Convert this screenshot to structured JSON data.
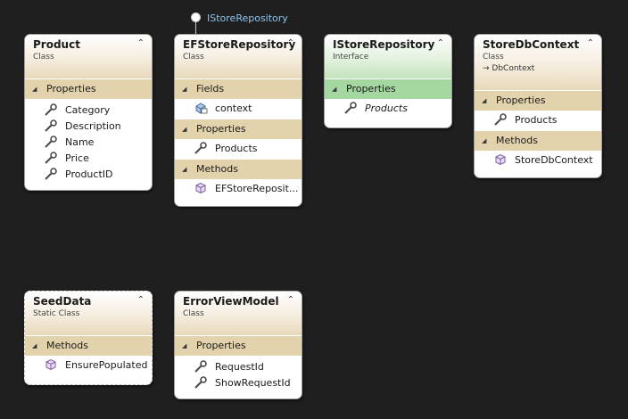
{
  "lollipop_label": "IStoreRepository",
  "collapse_glyph": "⌃",
  "section_glyph": "◢",
  "classes": {
    "product": {
      "title": "Product",
      "kind": "Class",
      "sections": [
        {
          "name": "Properties",
          "members": [
            "Category",
            "Description",
            "Name",
            "Price",
            "ProductID"
          ]
        }
      ]
    },
    "efstore": {
      "title": "EFStoreRepository",
      "kind": "Class",
      "sections": [
        {
          "name": "Fields",
          "members": [
            "context"
          ]
        },
        {
          "name": "Properties",
          "members": [
            "Products"
          ]
        },
        {
          "name": "Methods",
          "members": [
            "EFStoreReposit..."
          ]
        }
      ]
    },
    "istore": {
      "title": "IStoreRepository",
      "kind": "Interface",
      "sections": [
        {
          "name": "Properties",
          "members": [
            "Products"
          ]
        }
      ]
    },
    "storedb": {
      "title": "StoreDbContext",
      "kind": "Class",
      "base": "DbContext",
      "sections": [
        {
          "name": "Properties",
          "members": [
            "Products"
          ]
        },
        {
          "name": "Methods",
          "members": [
            "StoreDbContext"
          ]
        }
      ]
    },
    "seed": {
      "title": "SeedData",
      "kind": "Static Class",
      "sections": [
        {
          "name": "Methods",
          "members": [
            "EnsurePopulated"
          ]
        }
      ]
    },
    "errorvm": {
      "title": "ErrorViewModel",
      "kind": "Class",
      "sections": [
        {
          "name": "Properties",
          "members": [
            "RequestId",
            "ShowRequestId"
          ]
        }
      ]
    }
  },
  "colors": {
    "canvas": "#1f1f1f",
    "class_section": "#e3d3ad",
    "interface_section": "#a5d7a0",
    "lollipop_text": "#8cc4ee"
  }
}
